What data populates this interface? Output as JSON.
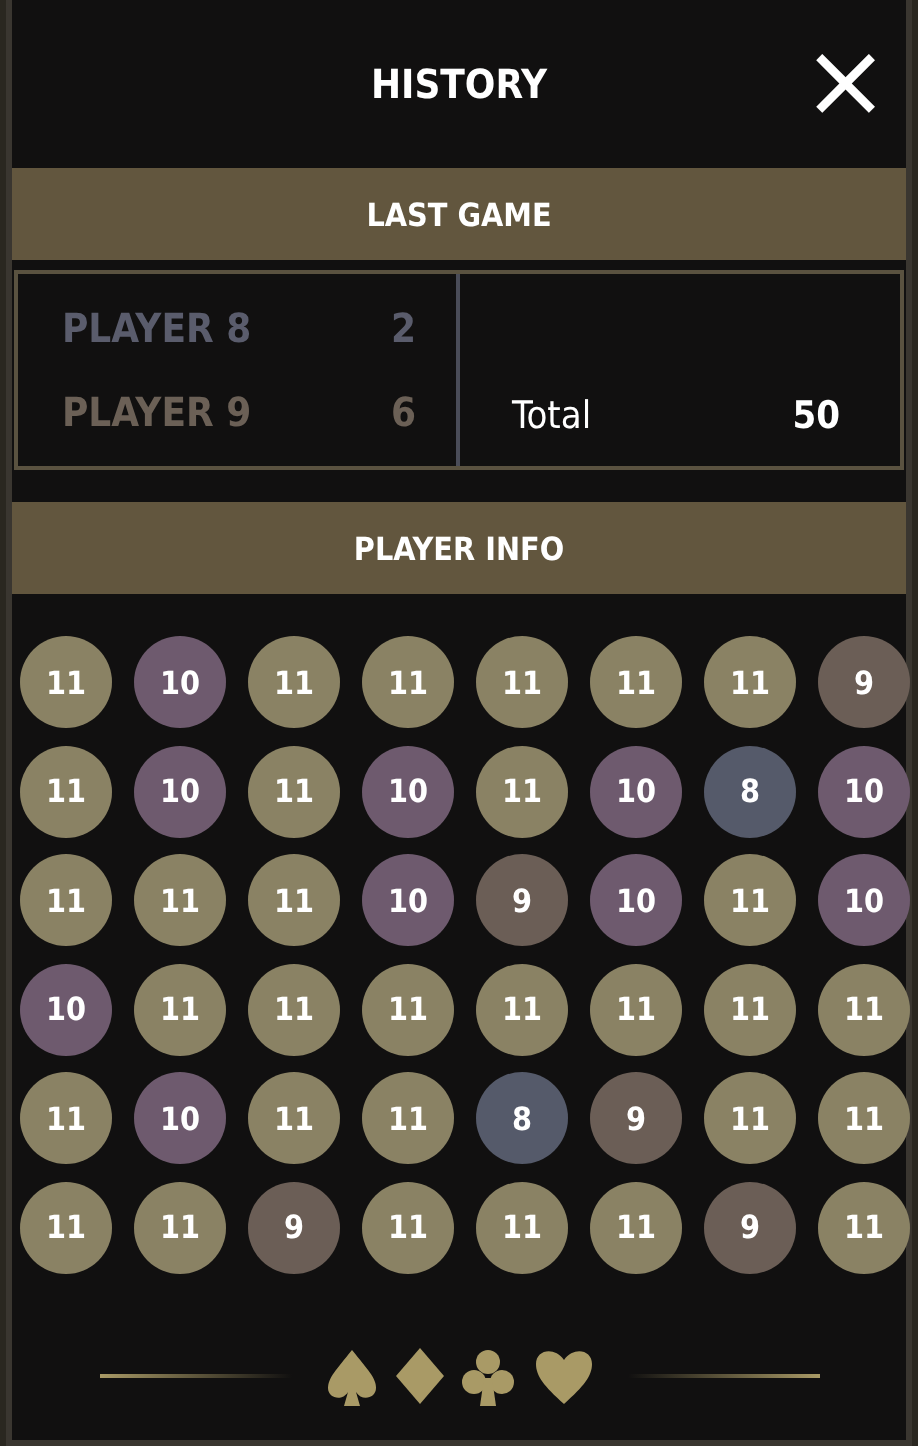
{
  "header": {
    "title": "HISTORY",
    "close": "×"
  },
  "last_game": {
    "title": "LAST GAME",
    "players": [
      {
        "name": "PLAYER 8",
        "score": "2",
        "color": "#5a5c6c"
      },
      {
        "name": "PLAYER 9",
        "score": "6",
        "color": "#6b6056"
      }
    ],
    "total_label": "Total",
    "total_value": "50"
  },
  "player_info": {
    "title": "PLAYER INFO",
    "rows": [
      [
        {
          "value": "11",
          "color": "#8a8264"
        },
        {
          "value": "10",
          "color": "#6e5a6e"
        },
        {
          "value": "11",
          "color": "#8a8264"
        },
        {
          "value": "11",
          "color": "#8a8264"
        },
        {
          "value": "11",
          "color": "#8a8264"
        },
        {
          "value": "11",
          "color": "#8a8264"
        },
        {
          "value": "11",
          "color": "#8a8264"
        },
        {
          "value": "9",
          "color": "#6b5e56"
        }
      ],
      [
        {
          "value": "11",
          "color": "#8a8264"
        },
        {
          "value": "10",
          "color": "#6e5a6e"
        },
        {
          "value": "11",
          "color": "#8a8264"
        },
        {
          "value": "10",
          "color": "#6e5a6e"
        },
        {
          "value": "11",
          "color": "#8a8264"
        },
        {
          "value": "10",
          "color": "#6e5a6e"
        },
        {
          "value": "8",
          "color": "#555a6a"
        },
        {
          "value": "10",
          "color": "#6e5a6e"
        }
      ],
      [
        {
          "value": "11",
          "color": "#8a8264"
        },
        {
          "value": "11",
          "color": "#8a8264"
        },
        {
          "value": "11",
          "color": "#8a8264"
        },
        {
          "value": "10",
          "color": "#6e5a6e"
        },
        {
          "value": "9",
          "color": "#6b5e56"
        },
        {
          "value": "10",
          "color": "#6e5a6e"
        },
        {
          "value": "11",
          "color": "#8a8264"
        },
        {
          "value": "10",
          "color": "#6e5a6e"
        }
      ],
      [
        {
          "value": "10",
          "color": "#6e5a6e"
        },
        {
          "value": "11",
          "color": "#8a8264"
        },
        {
          "value": "11",
          "color": "#8a8264"
        },
        {
          "value": "11",
          "color": "#8a8264"
        },
        {
          "value": "11",
          "color": "#8a8264"
        },
        {
          "value": "11",
          "color": "#8a8264"
        },
        {
          "value": "11",
          "color": "#8a8264"
        },
        {
          "value": "11",
          "color": "#8a8264"
        }
      ],
      [
        {
          "value": "11",
          "color": "#8a8264"
        },
        {
          "value": "10",
          "color": "#6e5a6e"
        },
        {
          "value": "11",
          "color": "#8a8264"
        },
        {
          "value": "11",
          "color": "#8a8264"
        },
        {
          "value": "8",
          "color": "#555a6a"
        },
        {
          "value": "9",
          "color": "#6b5e56"
        },
        {
          "value": "11",
          "color": "#8a8264"
        },
        {
          "value": "11",
          "color": "#8a8264"
        }
      ],
      [
        {
          "value": "11",
          "color": "#8a8264"
        },
        {
          "value": "11",
          "color": "#8a8264"
        },
        {
          "value": "9",
          "color": "#6b5e56"
        },
        {
          "value": "11",
          "color": "#8a8264"
        },
        {
          "value": "11",
          "color": "#8a8264"
        },
        {
          "value": "11",
          "color": "#8a8264"
        },
        {
          "value": "9",
          "color": "#6b5e56"
        },
        {
          "value": "11",
          "color": "#8a8264"
        }
      ]
    ]
  }
}
